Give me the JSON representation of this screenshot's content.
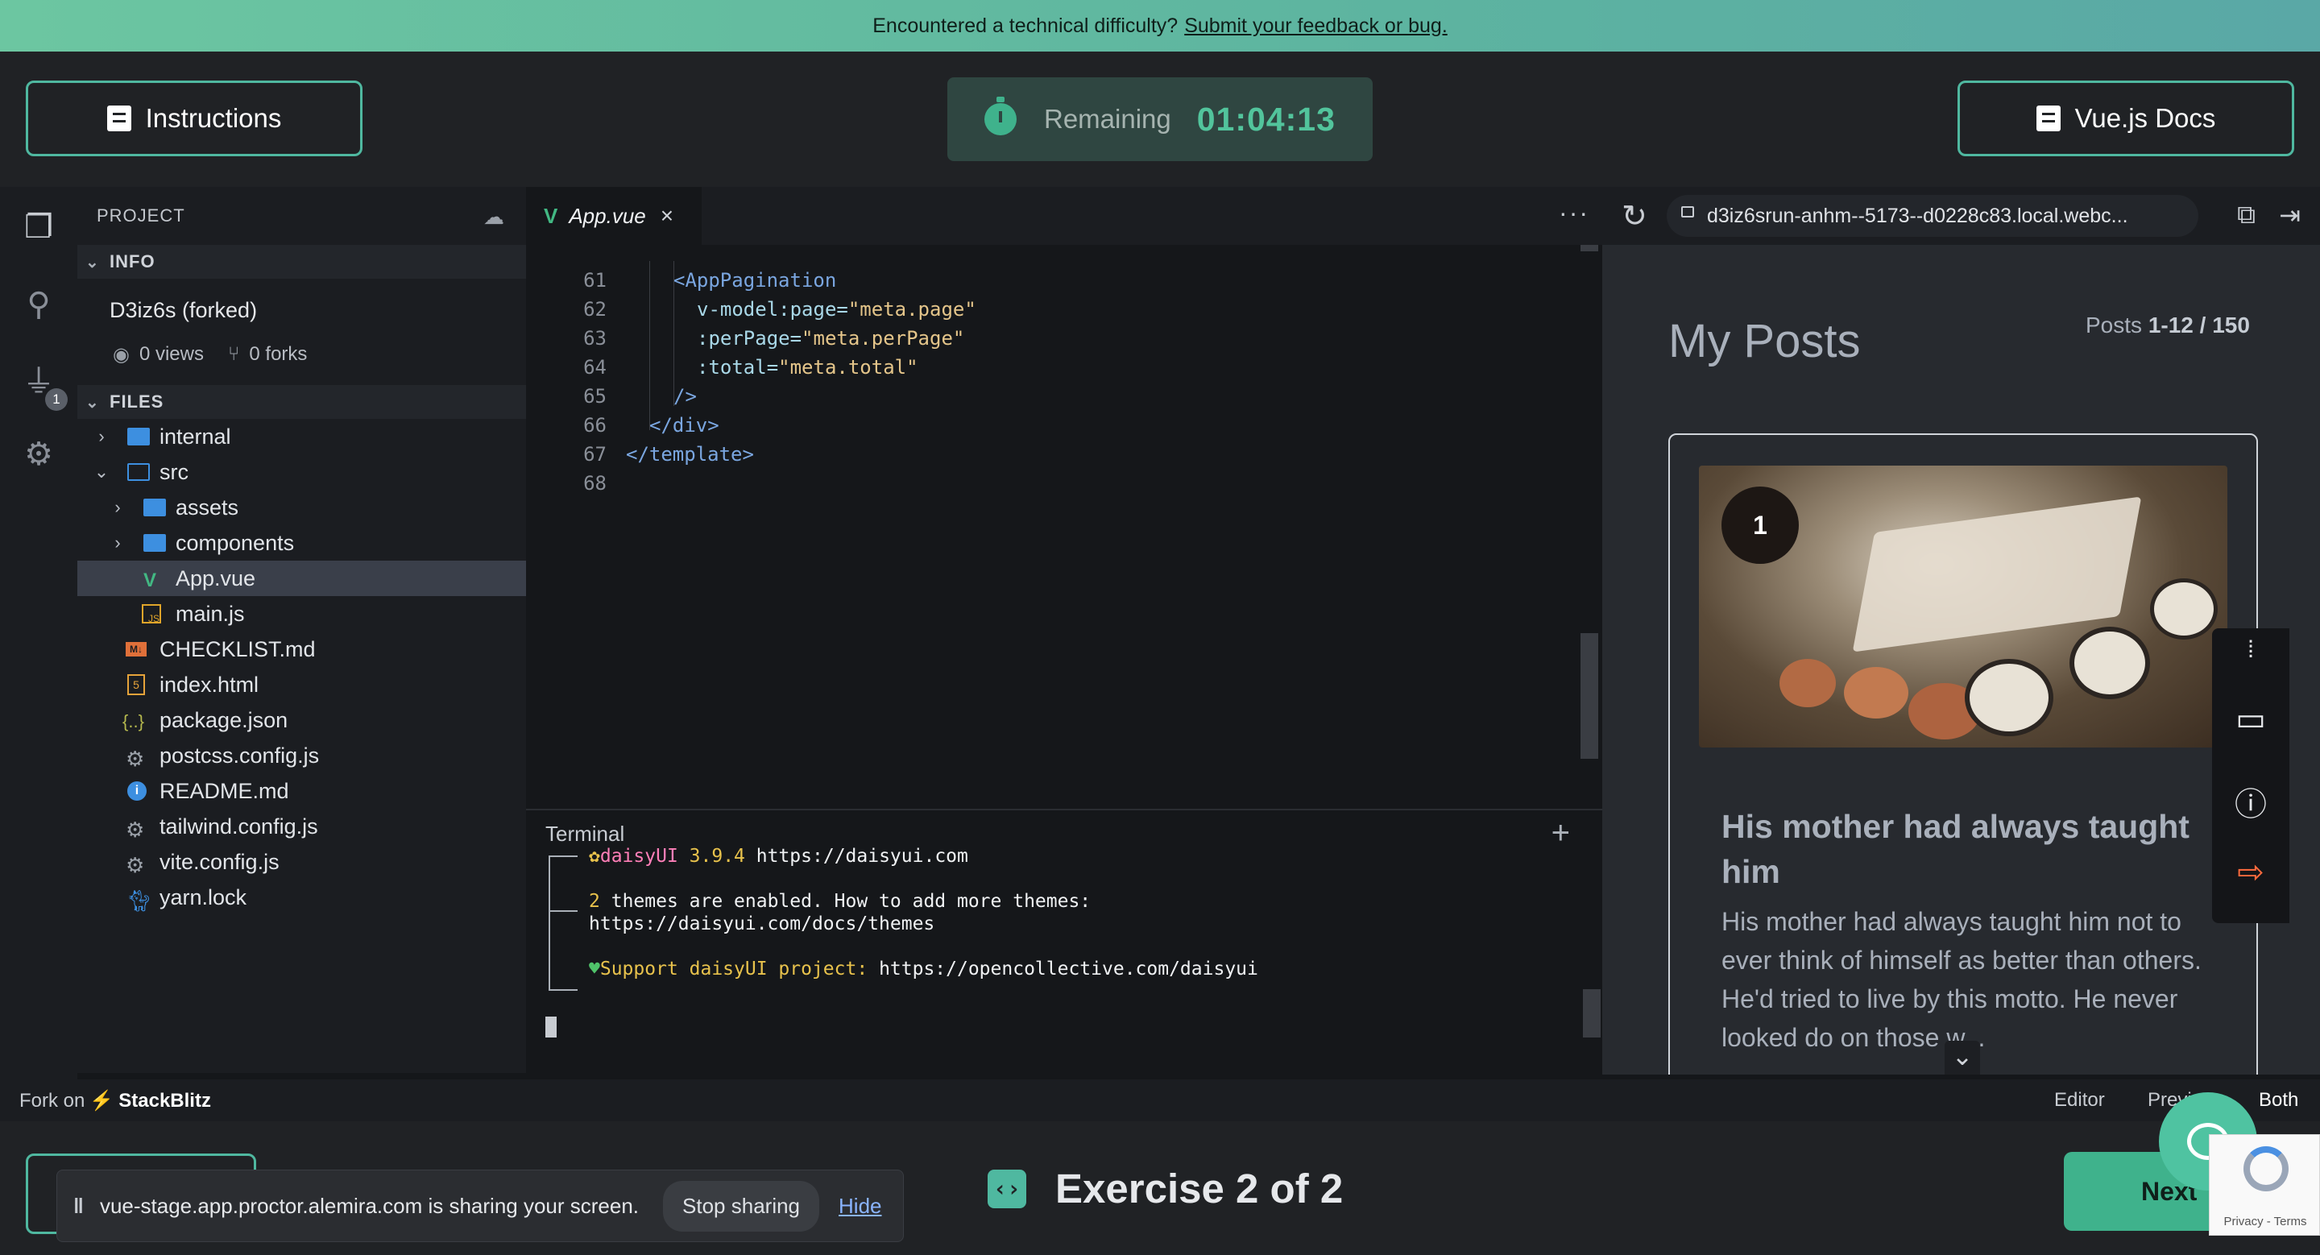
{
  "banner": {
    "text": "Encountered a technical difficulty?",
    "link": "Submit your feedback or bug."
  },
  "header": {
    "instructions_label": "Instructions",
    "timer_label": "Remaining",
    "timer_value": "01:04:13",
    "docs_label": "Vue.js Docs"
  },
  "sidebar": {
    "project_label": "PROJECT",
    "info_label": "INFO",
    "project_name": "D3iz6s (forked)",
    "views": "0 views",
    "forks": "0 forks",
    "files_label": "FILES",
    "badge": "1",
    "files": [
      {
        "name": "internal",
        "type": "folder"
      },
      {
        "name": "src",
        "type": "folder-open"
      },
      {
        "name": "assets",
        "type": "folder"
      },
      {
        "name": "components",
        "type": "folder"
      },
      {
        "name": "App.vue",
        "type": "vue"
      },
      {
        "name": "main.js",
        "type": "js"
      },
      {
        "name": "CHECKLIST.md",
        "type": "md"
      },
      {
        "name": "index.html",
        "type": "html"
      },
      {
        "name": "package.json",
        "type": "json"
      },
      {
        "name": "postcss.config.js",
        "type": "config"
      },
      {
        "name": "README.md",
        "type": "info"
      },
      {
        "name": "tailwind.config.js",
        "type": "config"
      },
      {
        "name": "vite.config.js",
        "type": "config"
      },
      {
        "name": "yarn.lock",
        "type": "yarn"
      }
    ]
  },
  "editor": {
    "tab_label": "App.vue",
    "line_numbers": [
      "61",
      "62",
      "63",
      "64",
      "65",
      "66",
      "67",
      "68"
    ],
    "lines": [
      {
        "t": "<AppPagination"
      },
      {
        "a": "v-model:page=",
        "s": "\"meta.page\""
      },
      {
        "a": ":perPage=",
        "s": "\"meta.perPage\""
      },
      {
        "a": ":total=",
        "s": "\"meta.total\""
      },
      {
        "t": "/>"
      },
      {
        "t": "</div>"
      },
      {
        "t": "</template>"
      },
      {
        "t": ""
      }
    ]
  },
  "terminal": {
    "title": "Terminal",
    "line1_name": "daisyUI",
    "line1_ver": "3.9.4",
    "line1_url": "https://daisyui.com",
    "line2_num": "2",
    "line2_text": "themes are enabled. How to add more themes:",
    "line3": "https://daisyui.com/docs/themes",
    "line4_label": "Support daisyUI project:",
    "line4_url": "https://opencollective.com/daisyui"
  },
  "preview": {
    "url": "d3iz6srun-anhm--5173--d0228c83.local.webc...",
    "title": "My Posts",
    "count_prefix": "Posts",
    "count_range": "1-12 / 150",
    "card_number": "1",
    "card_title": "His mother had always taught him",
    "card_body": "His mother had always taught him not to ever think of himself as better than others. He'd tried to live by this motto. He never looked do   on those w..."
  },
  "status": {
    "fork_prefix": "Fork on",
    "fork_brand": "StackBlitz",
    "modes": [
      "Editor",
      "Previ",
      "Both"
    ]
  },
  "bottom": {
    "share_text": "vue-stage.app.proctor.alemira.com is sharing your screen.",
    "stop_label": "Stop sharing",
    "hide_label": "Hide",
    "exercise_label": "Exercise 2 of 2",
    "next_label": "Next",
    "recaptcha_text": "Privacy - Terms"
  },
  "colors": {
    "accent": "#4fb8a0",
    "vue": "#42b883",
    "timer_green": "#52c49c"
  },
  "icons": [
    "files-icon",
    "search-icon",
    "plug-icon",
    "gear-icon",
    "cloud-download-icon",
    "eye-icon",
    "fork-icon",
    "reload-icon",
    "lock-icon",
    "external-link-icon",
    "close-panel-icon",
    "drag-handle-icon",
    "comment-icon",
    "info-icon",
    "logout-icon",
    "chat-icon",
    "code-icon"
  ]
}
